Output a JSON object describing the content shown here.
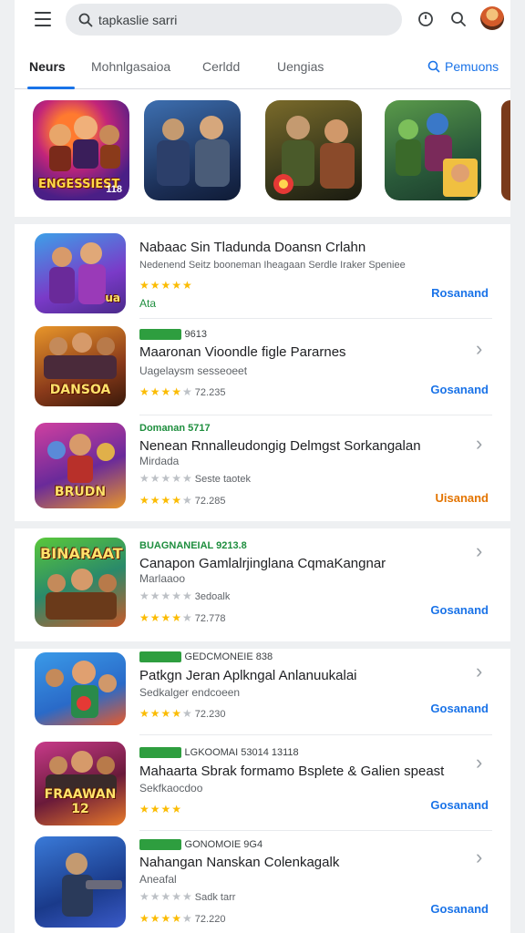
{
  "header": {
    "search_text": "tapkaslie sarri"
  },
  "tabs": {
    "items": [
      "Neurs",
      "Mohnlgasaioa",
      "Cerldd",
      "Uengias"
    ],
    "link": "Pemuons"
  },
  "featured": [
    {
      "label": "ENGESSIEST",
      "badge": "118"
    },
    {
      "label": ""
    },
    {
      "label": ""
    },
    {
      "label": ""
    },
    {
      "label": ""
    }
  ],
  "list": [
    {
      "tag": "",
      "title": "Nabaac Sin Tladunda Doansn Crlahn",
      "subtitle": "Nedenend Seitz booneman Iheagaan Serdle Iraker Speniee",
      "stars": "★★★★★",
      "rating": "",
      "extra": "Ata",
      "action": "Rosanand",
      "thumb_label": "ua"
    },
    {
      "tag": "9613",
      "title": "Maaronan Vioondle figle Pararnes",
      "subtitle": "Uagelaysm sesseoeet",
      "stars": "★★★★",
      "rating": "72.235",
      "action": "Gosanand",
      "thumb_label": "DANSOA"
    },
    {
      "tag": "Domanan 5717",
      "title": "Nenean Rnnalleudongig Delmgst Sorkangalan",
      "subtitle": "Mirdada",
      "sub2": "Seste taotek",
      "stars": "★★★★",
      "rating": "72.285",
      "action": "Uisanand",
      "thumb_label": "BRUDN"
    },
    {
      "tag": "BUAGNANEIAL 9213.8",
      "title": "Canapon Gamlalrjinglana CqmaKangnar",
      "subtitle": "Marlaaoo",
      "sub2": "3edoalk",
      "stars": "★★★★",
      "rating": "72.778",
      "action": "Gosanand",
      "thumb_label": "BINARAAT"
    },
    {
      "tag": "GEDCMONEIE 838",
      "title": "Patkgn Jeran Aplkngal Anlanuukalai",
      "subtitle": "Sedkalger endcoeen",
      "stars": "★★★★",
      "rating": "72.230",
      "action": "Gosanand",
      "thumb_label": ""
    },
    {
      "tag": "LGKOOMAI 53014 13118",
      "title": "Mahaarta Sbrak formamo Bsplete & Galien speast",
      "subtitle": "Sekfkaocdoo",
      "stars": "★★★★",
      "rating": "",
      "action": "Gosanand",
      "thumb_label": "FRAAWAN 12"
    },
    {
      "tag": "GONOMOIE 9G4",
      "title": "Nahangan Nanskan Colenkagalk",
      "subtitle": "Aneafal",
      "sub2": "Sadk tarr",
      "stars": "★★★★",
      "rating": "72.220",
      "action": "Gosanand",
      "thumb_label": ""
    }
  ]
}
